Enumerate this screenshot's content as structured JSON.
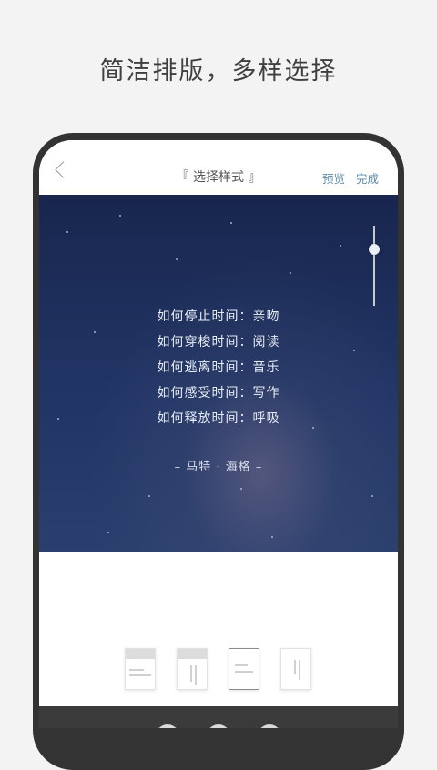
{
  "headline": "简洁排版，多样选择",
  "nav": {
    "title": "『 选择样式 』",
    "preview": "预览",
    "done": "完成"
  },
  "poem": {
    "lines": [
      "如何停止时间：亲吻",
      "如何穿梭时间：阅读",
      "如何逃离时间：音乐",
      "如何感受时间：写作",
      "如何释放时间：呼吸"
    ],
    "author": "– 马特 · 海格 –"
  },
  "slider": {
    "value": 0.3
  },
  "layout_styles": [
    {
      "name": "style-1",
      "selected": false
    },
    {
      "name": "style-2",
      "selected": false
    },
    {
      "name": "style-3",
      "selected": true
    },
    {
      "name": "style-4",
      "selected": false
    }
  ],
  "colors": {
    "background": "#f3f3f3",
    "phone_frame": "#333333",
    "accent": "#5b8aa8",
    "art_top": "#18264e",
    "art_bottom": "#2a3f6e"
  }
}
